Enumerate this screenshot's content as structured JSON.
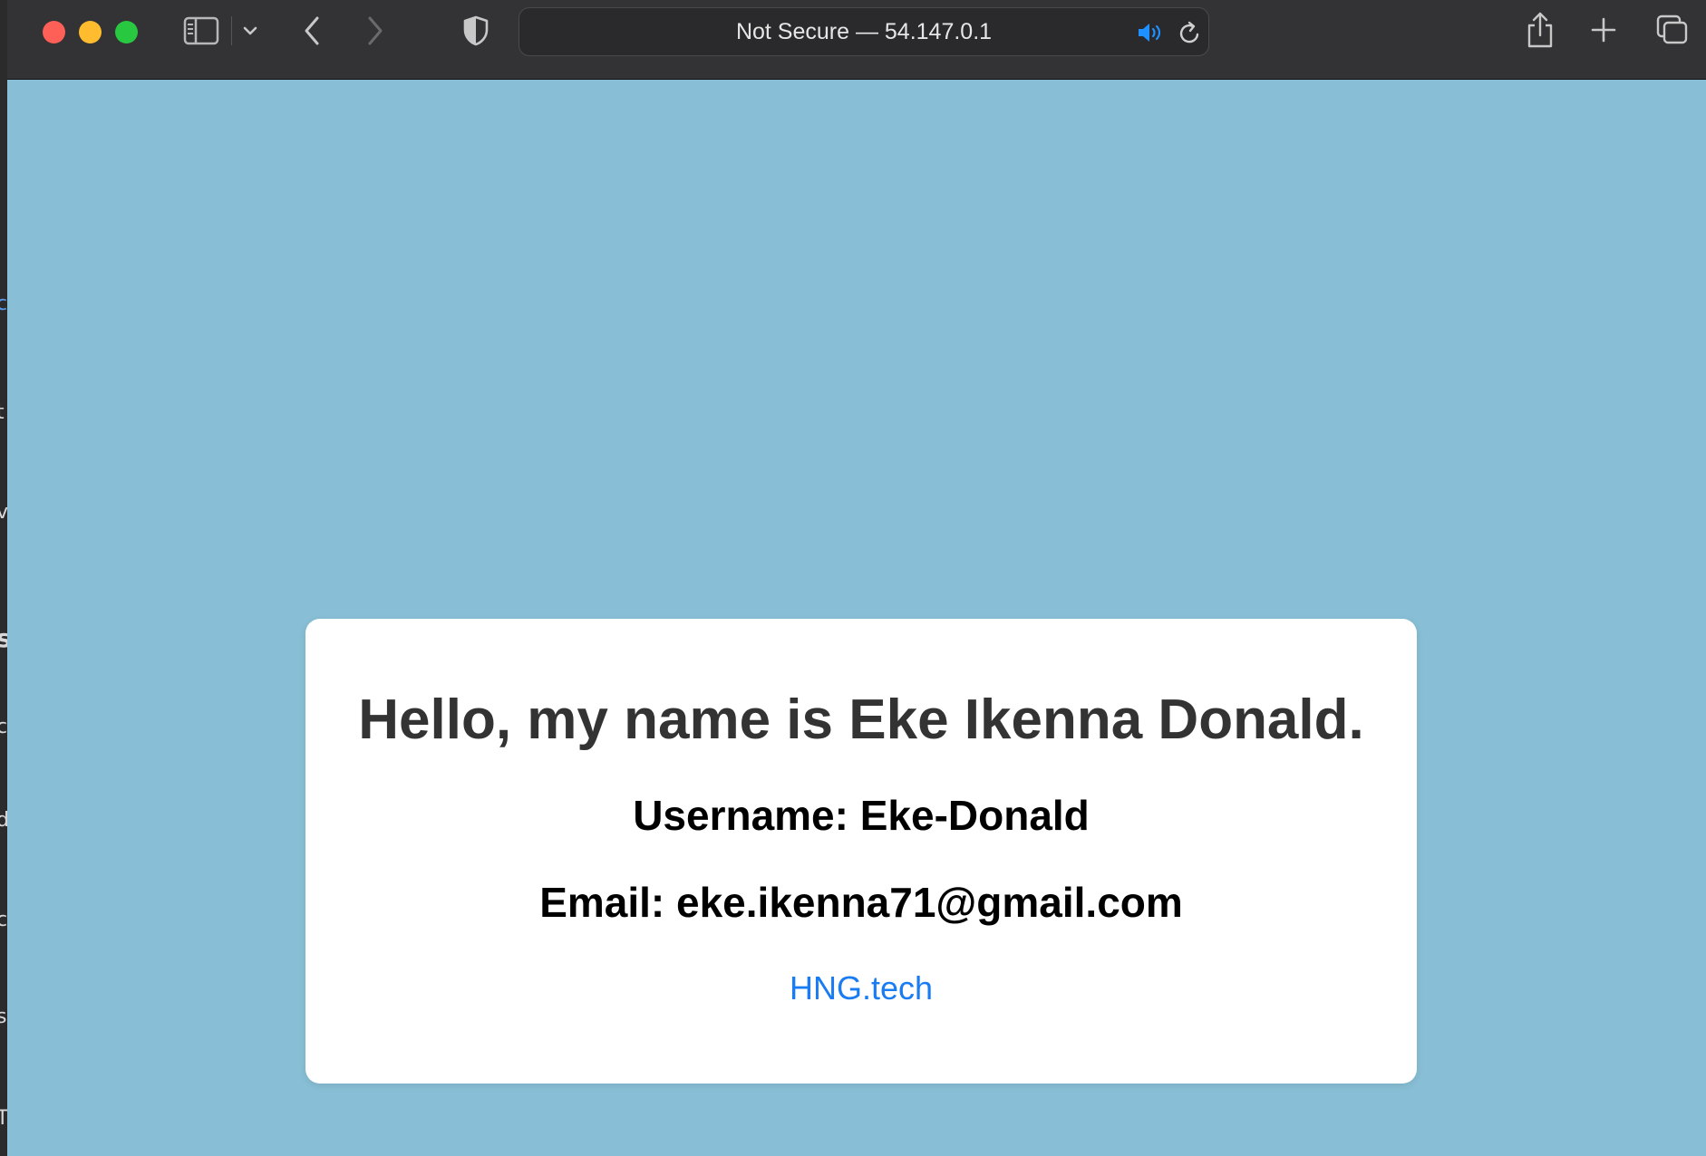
{
  "browser": {
    "address_bar": {
      "text": "Not Secure — 54.147.0.1"
    },
    "icons": {
      "close": "close-window",
      "minimize": "minimize-window",
      "zoom": "zoom-window",
      "sidebar": "sidebar-toggle",
      "tab_group_menu": "chevron-down",
      "back": "chevron-left",
      "forward": "chevron-right",
      "privacy": "shield",
      "audio": "speaker-audio",
      "reload": "reload",
      "share": "share",
      "new_tab": "plus",
      "tab_overview": "tab-overview"
    },
    "colors": {
      "close": "#fe5f57",
      "minimize": "#febc2e",
      "zoom": "#28c840",
      "audio": "#1e90ff"
    }
  },
  "page": {
    "background_color": "#88bfd6",
    "card": {
      "headline": "Hello, my name is Eke Ikenna Donald.",
      "username_line": "Username: Eke-Donald",
      "email_line": "Email: eke.ikenna71@gmail.com",
      "link_text": "HNG.tech"
    },
    "link_color": "#1a7cf2"
  },
  "background_window_edge": {
    "clipped_characters": [
      "c",
      "t",
      "v",
      "s",
      "c",
      "d",
      "c",
      "s",
      "T"
    ]
  }
}
